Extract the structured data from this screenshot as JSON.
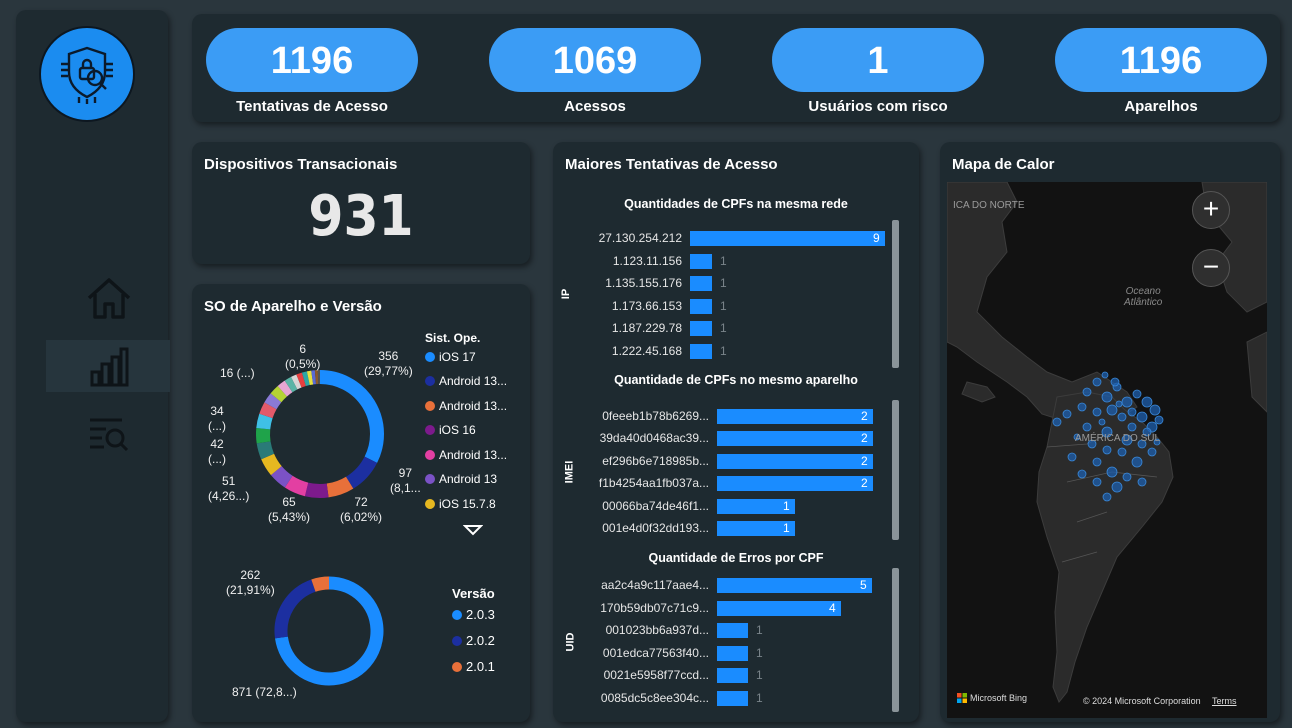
{
  "kpis": [
    {
      "value": "1196",
      "label": "Tentativas de Acesso"
    },
    {
      "value": "1069",
      "label": "Acessos"
    },
    {
      "value": "1",
      "label": "Usuários com risco"
    },
    {
      "value": "1196",
      "label": "Aparelhos"
    }
  ],
  "nav": {
    "logo_icon": "shield-lock-icon",
    "items": [
      {
        "icon": "home-icon",
        "active": false
      },
      {
        "icon": "bar-chart-icon",
        "active": true
      },
      {
        "icon": "search-list-icon",
        "active": false
      }
    ]
  },
  "dispositivos": {
    "title": "Dispositivos Transacionais",
    "value": "931"
  },
  "so": {
    "title": "SO de Aparelho e Versão",
    "legend_title": "Sist. Ope.",
    "legend": [
      {
        "label": "iOS 17",
        "color": "#1a8cff"
      },
      {
        "label": "Android 13...",
        "color": "#1c2fa0"
      },
      {
        "label": "Android 13...",
        "color": "#e8703a"
      },
      {
        "label": "iOS 16",
        "color": "#7d1a8c"
      },
      {
        "label": "Android 13...",
        "color": "#e33fa2"
      },
      {
        "label": "Android 13",
        "color": "#7b52c6"
      },
      {
        "label": "iOS 15.7.8",
        "color": "#e6b820"
      }
    ],
    "labels": {
      "l356a": "356",
      "l356b": "(29,77%)",
      "l97a": "97",
      "l97b": "(8,1...",
      "l72a": "72",
      "l72b": "(6,02%)",
      "l65a": "65",
      "l65b": "(5,43%)",
      "l51a": "51",
      "l51b": "(4,26...)",
      "l42a": "42",
      "l42b": "(...)",
      "l34a": "34",
      "l34b": "(...)",
      "l16": "16 (...)",
      "l6a": "6",
      "l6b": "(0,5%)"
    },
    "more_icon": "triangle-down-icon"
  },
  "versao": {
    "legend_title": "Versão",
    "legend": [
      {
        "label": "2.0.3",
        "color": "#1a8cff"
      },
      {
        "label": "2.0.2",
        "color": "#1c2fa0"
      },
      {
        "label": "2.0.1",
        "color": "#e8703a"
      }
    ],
    "labels": {
      "l262a": "262",
      "l262b": "(21,91%)",
      "l871": "871 (72,8...)"
    }
  },
  "maiores": {
    "title": "Maiores Tentativas de Acesso",
    "rede": {
      "title": "Quantidades de CPFs na mesma rede",
      "axis": "IP",
      "rows": [
        {
          "label": "27.130.254.212",
          "value": 9
        },
        {
          "label": "1.123.11.156",
          "value": 1
        },
        {
          "label": "1.135.155.176",
          "value": 1
        },
        {
          "label": "1.173.66.153",
          "value": 1
        },
        {
          "label": "1.187.229.78",
          "value": 1
        },
        {
          "label": "1.222.45.168",
          "value": 1
        }
      ]
    },
    "aparelho": {
      "title": "Quantidade de CPFs no mesmo aparelho",
      "axis": "IMEI",
      "rows": [
        {
          "label": "0feeeb1b78b6269...",
          "value": 2
        },
        {
          "label": "39da40d0468ac39...",
          "value": 2
        },
        {
          "label": "ef296b6e718985b...",
          "value": 2
        },
        {
          "label": "f1b4254aa1fb037a...",
          "value": 2
        },
        {
          "label": "00066ba74de46f1...",
          "value": 1
        },
        {
          "label": "001e4d0f32dd193...",
          "value": 1
        }
      ]
    },
    "erros": {
      "title": "Quantidade de Erros por CPF",
      "axis": "UID",
      "rows": [
        {
          "label": "aa2c4a9c117aae4...",
          "value": 5
        },
        {
          "label": "170b59db07c71c9...",
          "value": 4
        },
        {
          "label": "001023bb6a937d...",
          "value": 1
        },
        {
          "label": "001edca77563f40...",
          "value": 1
        },
        {
          "label": "0021e5958f77ccd...",
          "value": 1
        },
        {
          "label": "0085dc5c8ee304c...",
          "value": 1
        }
      ]
    }
  },
  "mapa": {
    "title": "Mapa de Calor",
    "zoom_in": "+",
    "zoom_out": "−",
    "label_north": "ICA DO NORTE",
    "label_ocean_1": "Oceano",
    "label_ocean_2": "Atlântico",
    "label_south": "AMÉRICA DO SUL",
    "bing": "Microsoft Bing",
    "copyright": "© 2024 Microsoft Corporation",
    "terms": "Terms"
  }
}
